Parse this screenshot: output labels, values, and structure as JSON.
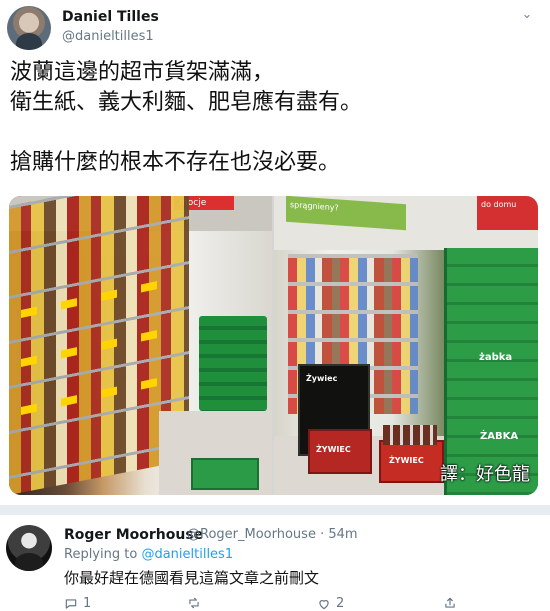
{
  "tweet": {
    "name": "Daniel Tilles",
    "handle": "@danieltilles1",
    "text": "波蘭這邊的超市貨架滿滿，\n衛生紙、義大利麵、肥皂應有盡有。\n\n搶購什麼的根本不存在也沒必要。",
    "watermark": "譯：好色龍",
    "photo_labels": {
      "left_red_sign": "mocje",
      "right_green_banner": "sprągnieny?",
      "right_red_banner": "do domu",
      "crate_1": "Żywiec",
      "crate_2": "ŻYWIEC",
      "crate_3": "ŻYWIEC",
      "stack_label_1": "żabka",
      "stack_label_2": "ŻABKA"
    }
  },
  "reply": {
    "name": "Roger Moorhouse",
    "handle": "@Roger_Moorhouse · 54m",
    "replying_prefix": "Replying to ",
    "replying_to": "@danieltilles1",
    "text": "你最好趕在德國看見這篇文章之前刪文",
    "actions": {
      "reply_count": "1",
      "retweet_count": "",
      "like_count": "2"
    }
  },
  "icons": {
    "caret": "chevron-down-icon",
    "reply": "comment-icon",
    "retweet": "retweet-icon",
    "like": "heart-icon",
    "share": "share-icon"
  }
}
